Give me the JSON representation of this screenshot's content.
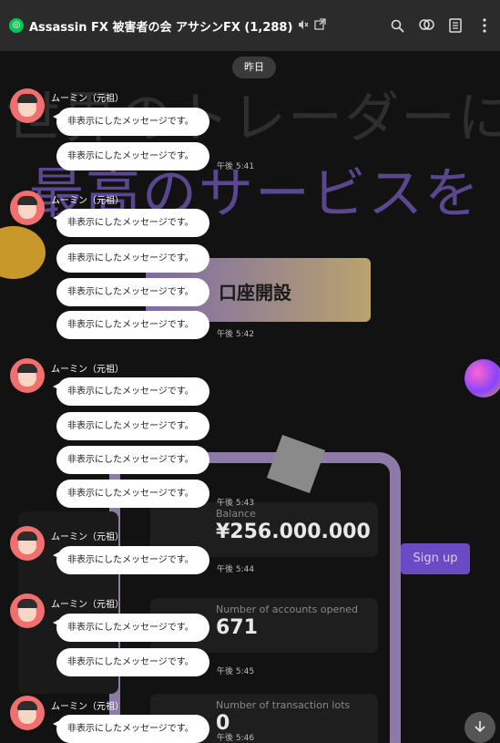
{
  "header": {
    "chat_title": "Assassin FX 被害者の会 アサシンFX (1,288)",
    "icons": [
      "app-logo-icon",
      "mute-icon",
      "external-window-icon",
      "search-icon",
      "chat-icon",
      "notes-icon",
      "more-icon"
    ]
  },
  "background": {
    "headline1": "世界のトレーダーに",
    "headline2": "最高のサービスを",
    "button_label": "口座開設",
    "card1_label": "Balance",
    "card1_value": "¥256.000.000",
    "card2_label": "Number of accounts opened",
    "card2_value": "671",
    "card3_label": "Number of transaction lots",
    "card3_value": "0",
    "signup": "Sign up"
  },
  "date_separator": "昨日",
  "hidden_text": "非表示にしたメッセージです。",
  "sender": "ムーミン（元祖）",
  "timestamps": [
    "午後 5:41",
    "午後 5:42",
    "午後 5:43",
    "午後 5:44",
    "午後 5:45",
    "午後 5:46"
  ],
  "colors": {
    "app_green": "#06c755",
    "avatar_bg": "#f26f6f",
    "titlebar": "#2b2b2b"
  }
}
